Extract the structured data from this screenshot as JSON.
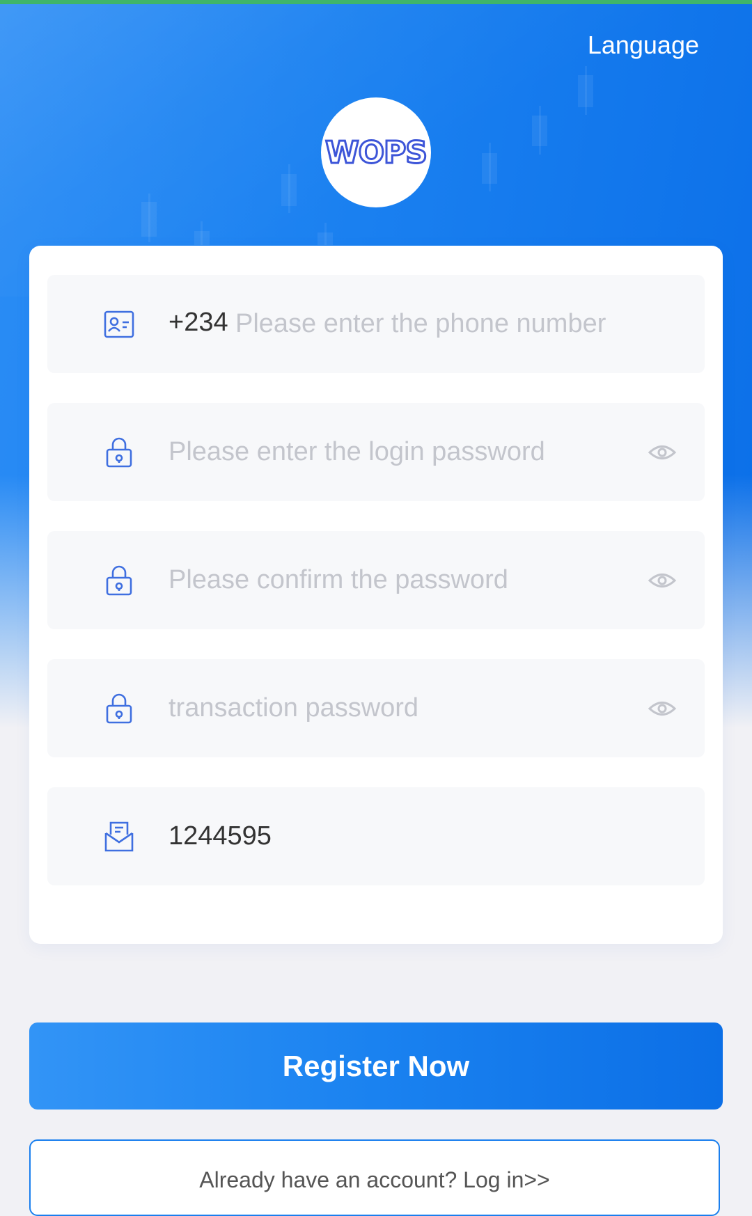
{
  "header": {
    "language_label": "Language",
    "logo_text": "WOPS"
  },
  "form": {
    "phone": {
      "country_code": "+234",
      "placeholder": "Please enter the phone number",
      "value": ""
    },
    "login_password": {
      "placeholder": "Please enter the login password",
      "value": ""
    },
    "confirm_password": {
      "placeholder": "Please confirm the password",
      "value": ""
    },
    "transaction_password": {
      "placeholder": "transaction password",
      "value": ""
    },
    "invite_code": {
      "placeholder": "",
      "value": "1244595"
    }
  },
  "actions": {
    "register_label": "Register Now",
    "login_link": "Already have an account? Log in>>"
  },
  "colors": {
    "primary": "#1a80f0",
    "icon": "#3f6fe0",
    "field_bg": "#f7f8fa",
    "placeholder": "#c3c5cc"
  },
  "icons": {
    "phone": "id-card-icon",
    "password": "lock-icon",
    "toggle": "eye-icon",
    "invite": "envelope-icon"
  }
}
